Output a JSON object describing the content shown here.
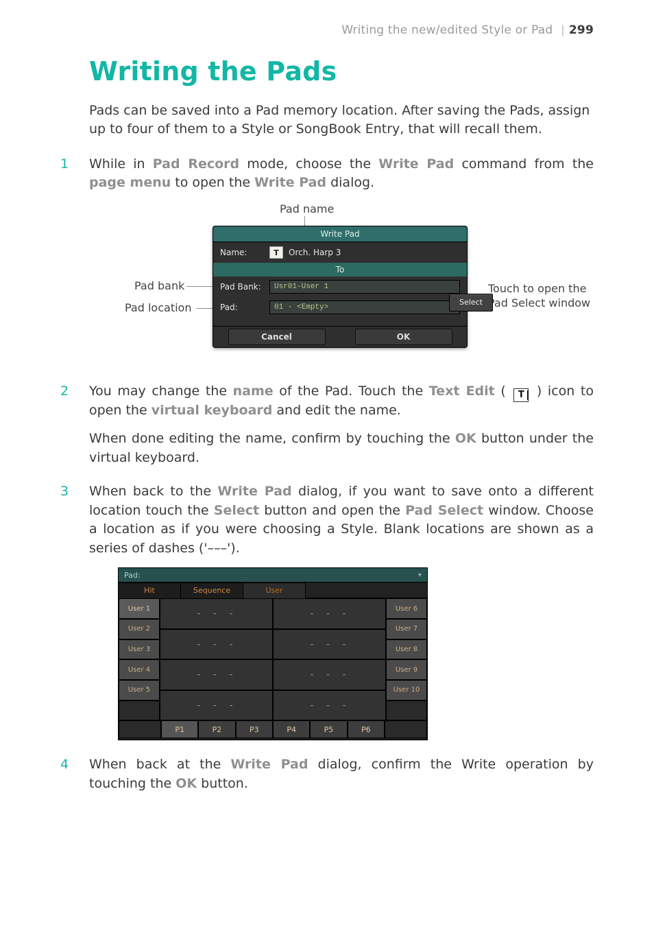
{
  "header": {
    "section": "Writing the new/edited Style or Pad",
    "page_number": "299"
  },
  "title": "Writing the Pads",
  "intro": "Pads can be saved into a Pad memory location. After saving the Pads, assign up to four of them to a Style or SongBook Entry, that will recall them.",
  "steps": {
    "s1": {
      "num": "1",
      "a": "While in ",
      "t1": "Pad Record",
      "b": " mode, choose the ",
      "t2": "Write Pad",
      "c": " command from the ",
      "t3": "page menu",
      "d": " to open the ",
      "t4": "Write Pad",
      "e": " dialog."
    },
    "s2": {
      "num": "2",
      "a": "You may change the ",
      "t1": "name",
      "b": " of the Pad. Touch the ",
      "t2": "Text Edit",
      "c": " ( ",
      "d": " ) icon to open the ",
      "t3": "virtual keyboard",
      "e": " and edit the name.",
      "p2a": "When done editing the name, confirm by touching the ",
      "t4": "OK",
      "p2b": " button under the virtual keyboard."
    },
    "s3": {
      "num": "3",
      "a": "When back to the ",
      "t1": "Write Pad",
      "b": " dialog, if you want to save onto a different location touch the ",
      "t2": "Select",
      "c": " button and open the ",
      "t3": "Pad Select",
      "d": " window. Choose a location as if you were choosing a Style. Blank locations are shown as a series of dashes ('–––')."
    },
    "s4": {
      "num": "4",
      "a": "When back at the ",
      "t1": "Write Pad",
      "b": " dialog, confirm the Write operation by touching the ",
      "t2": "OK",
      "c": " button."
    }
  },
  "callouts": {
    "pad_name": "Pad name",
    "pad_bank": "Pad bank",
    "pad_location": "Pad location",
    "open_pad_select": "Touch to open the Pad Select window"
  },
  "dialog": {
    "title": "Write Pad",
    "name_label": "Name:",
    "name_value": "Orch. Harp 3",
    "t_glyph": "T",
    "to_label": "To",
    "padbank_label": "Pad Bank:",
    "padbank_value": "Usr01-User 1",
    "pad_label": "Pad:",
    "pad_value": "01 - <Empty>",
    "select": "Select",
    "cancel": "Cancel",
    "ok": "OK"
  },
  "padselect": {
    "head": "Pad:",
    "tabs": {
      "hit": "Hit",
      "sequence": "Sequence",
      "user": "User"
    },
    "left": [
      "User 1",
      "User 2",
      "User 3",
      "User 4",
      "User 5"
    ],
    "right": [
      "User 6",
      "User 7",
      "User 8",
      "User 9",
      "User 10"
    ],
    "empty_cell": "- - -",
    "pages": [
      "P1",
      "P2",
      "P3",
      "P4",
      "P5",
      "P6"
    ]
  },
  "glyphs": {
    "inline_T": "T"
  }
}
